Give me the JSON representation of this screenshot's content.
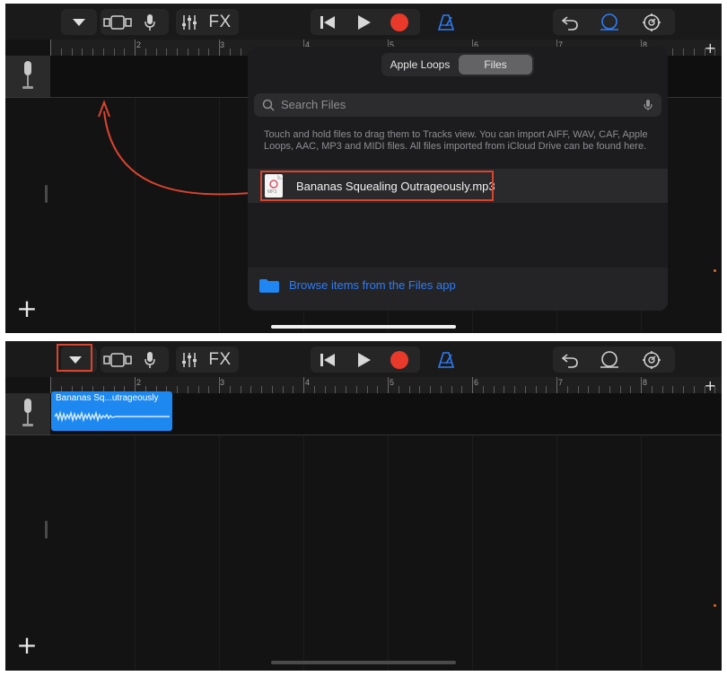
{
  "toolbar": {
    "fx_label": "FX",
    "icons": [
      "triangle-down-icon",
      "tracks-view-icon",
      "microphone-icon",
      "mixer-icon",
      "fx-icon",
      "rewind-icon",
      "play-icon",
      "record-icon",
      "metronome-icon",
      "undo-icon",
      "loop-browser-icon",
      "settings-icon"
    ],
    "record_color": "#e8392b",
    "accent_color": "#2e7cf6"
  },
  "ruler": {
    "bars": [
      "2",
      "3",
      "4",
      "5",
      "6",
      "7",
      "8"
    ]
  },
  "browser": {
    "tabs": [
      {
        "label": "Apple Loops",
        "active": false
      },
      {
        "label": "Files",
        "active": true
      }
    ],
    "search_placeholder": "Search Files",
    "hint": "Touch and hold files to drag them to Tracks view. You can import AIFF, WAV, CAF, Apple Loops, AAC, MP3 and MIDI files. All files imported from iCloud Drive can be found here.",
    "file_name": "Bananas Squealing Outrageously.mp3",
    "file_icon_label": "MP3",
    "browse_label": "Browse items from the Files app"
  },
  "region": {
    "label": "Bananas Sq...utrageously"
  },
  "annotation_color": "#d9442e",
  "add_track_label": "+",
  "add_section_label": "+"
}
